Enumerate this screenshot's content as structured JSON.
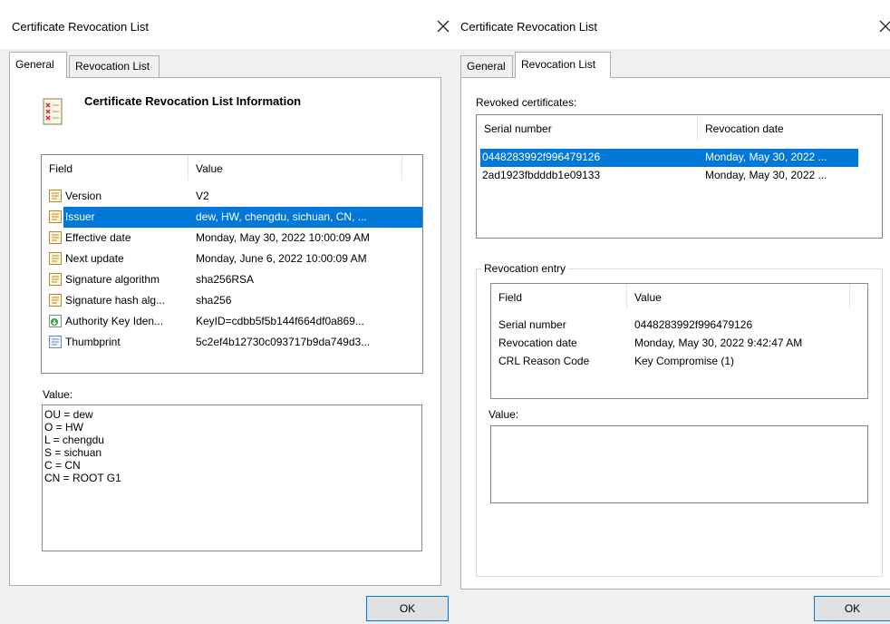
{
  "left_dialog": {
    "title": "Certificate Revocation List",
    "tabs": [
      {
        "label": "General",
        "active": true
      },
      {
        "label": "Revocation List",
        "active": false
      }
    ],
    "info_heading": "Certificate Revocation List Information",
    "columns": [
      "Field",
      "Value"
    ],
    "fields": [
      {
        "field": "Version",
        "value": "V2",
        "icon": "document-icon"
      },
      {
        "field": "Issuer",
        "value": "dew, HW, chengdu, sichuan, CN, ...",
        "icon": "document-icon",
        "selected": true
      },
      {
        "field": "Effective date",
        "value": "Monday, May 30, 2022 10:00:09 AM",
        "icon": "document-icon"
      },
      {
        "field": "Next update",
        "value": "Monday, June 6, 2022 10:00:09 AM",
        "icon": "document-icon"
      },
      {
        "field": "Signature algorithm",
        "value": "sha256RSA",
        "icon": "document-icon"
      },
      {
        "field": "Signature hash alg...",
        "value": "sha256",
        "icon": "document-icon"
      },
      {
        "field": "Authority Key Iden...",
        "value": "KeyID=cdbb5f5b144f664df0a869...",
        "icon": "extension-icon"
      },
      {
        "field": "Thumbprint",
        "value": "5c2ef4b12730c093717b9da749d3...",
        "icon": "document-icon"
      }
    ],
    "value_label": "Value:",
    "value_lines": [
      "OU = dew",
      "O = HW",
      "L = chengdu",
      "S = sichuan",
      "C = CN",
      "CN = ROOT G1"
    ],
    "ok_label": "OK"
  },
  "right_dialog": {
    "title": "Certificate Revocation List",
    "tabs": [
      {
        "label": "General",
        "active": false
      },
      {
        "label": "Revocation List",
        "active": true
      }
    ],
    "revoked_label": "Revoked certificates:",
    "revoked_columns": [
      "Serial number",
      "Revocation date"
    ],
    "revoked_rows": [
      {
        "serial": "0448283992f996479126",
        "date": "Monday, May 30, 2022 ...",
        "selected": true
      },
      {
        "serial": "2ad1923fbdddb1e09133",
        "date": "Monday, May 30, 2022 ...",
        "selected": false
      }
    ],
    "entry_group_label": "Revocation entry",
    "entry_columns": [
      "Field",
      "Value"
    ],
    "entry_rows": [
      {
        "field": "Serial number",
        "value": "0448283992f996479126"
      },
      {
        "field": "Revocation date",
        "value": "Monday, May 30, 2022 9:42:47 AM"
      },
      {
        "field": "CRL Reason Code",
        "value": "Key Compromise (1)"
      }
    ],
    "value_label": "Value:",
    "ok_label": "OK"
  },
  "colors": {
    "selection": "#0078d7",
    "dialog_bg": "#f0f0f0",
    "button_border": "#0078d7"
  }
}
